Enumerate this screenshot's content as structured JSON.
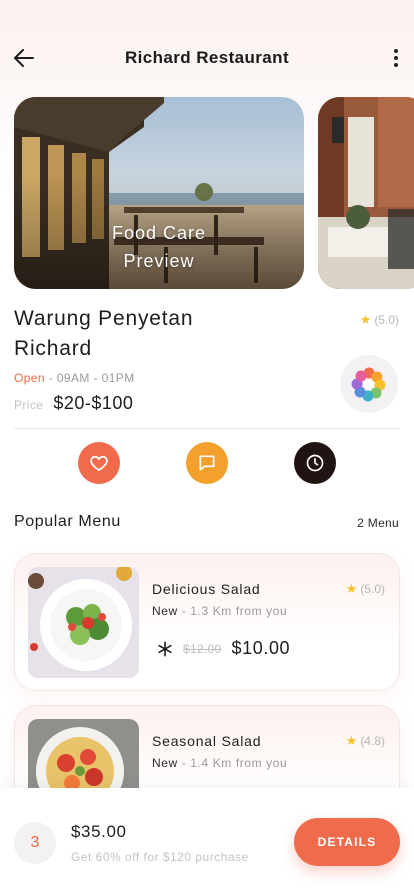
{
  "header": {
    "title": "Richard Restaurant",
    "back_icon": "arrow-left-icon",
    "more_icon": "more-vertical-icon"
  },
  "gallery": {
    "items": [
      {
        "caption": "Food Care\nPreview"
      },
      {
        "caption": ""
      }
    ]
  },
  "restaurant": {
    "name": "Warung Penyetan Richard",
    "rating": "(5.0)",
    "status": "Open",
    "hours": " - 09AM - 01PM",
    "price_label": "Price",
    "price_range": "$20-$100"
  },
  "actions": [
    {
      "icon": "heart-icon",
      "color": "#f06b4c"
    },
    {
      "icon": "message-icon",
      "color": "#f4a02c"
    },
    {
      "icon": "clock-icon",
      "color": "#1f1412"
    }
  ],
  "popular": {
    "title": "Popular Menu",
    "count": "2 Menu"
  },
  "menu": [
    {
      "name": "Delicious Salad",
      "rating": "(5.0)",
      "tag": "New",
      "distance": " - 1.3 Km from you",
      "old_price": "$12.00",
      "price": "$10.00"
    },
    {
      "name": "Seasonal Salad",
      "rating": "(4.8)",
      "tag": "New",
      "distance": " - 1.4 Km from you"
    }
  ],
  "bottom": {
    "quantity": "3",
    "total": "$35.00",
    "promo": "Get 60% off for $120 purchase",
    "details_label": "DETAILS"
  },
  "colors": {
    "accent": "#f06b4c",
    "secondary": "#f4a02c",
    "dark": "#1f1412",
    "star": "#f6c12c"
  }
}
